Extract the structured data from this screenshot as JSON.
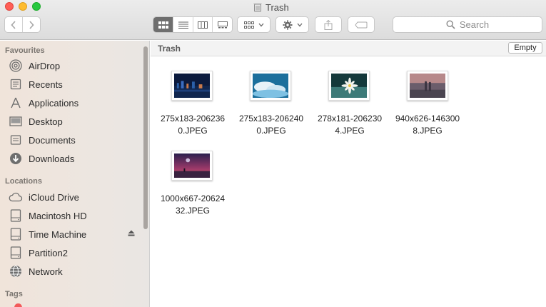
{
  "window": {
    "title": "Trash"
  },
  "toolbar": {
    "back_icon": "chevron-left-icon",
    "forward_icon": "chevron-right-icon",
    "view_modes": [
      "icon-view",
      "list-view",
      "column-view",
      "gallery-view"
    ],
    "active_view": "icon-view",
    "search_placeholder": "Search"
  },
  "sidebar": {
    "favourites_title": "Favourites",
    "favourites": [
      {
        "label": "AirDrop",
        "icon": "airdrop-icon"
      },
      {
        "label": "Recents",
        "icon": "recents-icon"
      },
      {
        "label": "Applications",
        "icon": "applications-icon"
      },
      {
        "label": "Desktop",
        "icon": "desktop-icon"
      },
      {
        "label": "Documents",
        "icon": "documents-icon"
      },
      {
        "label": "Downloads",
        "icon": "downloads-icon"
      }
    ],
    "locations_title": "Locations",
    "locations": [
      {
        "label": "iCloud Drive",
        "icon": "icloud-icon"
      },
      {
        "label": "Macintosh HD",
        "icon": "hard-drive-icon"
      },
      {
        "label": "Time Machine",
        "icon": "time-machine-icon"
      },
      {
        "label": "Partition2",
        "icon": "hard-drive-icon"
      },
      {
        "label": "Network",
        "icon": "network-icon"
      }
    ],
    "tags_title": "Tags"
  },
  "main": {
    "path_label": "Trash",
    "empty_button": "Empty",
    "files": [
      {
        "line1": "275x183-206236",
        "line2": "0.JPEG",
        "colors": [
          "#0b1a3d",
          "#2a5fa8",
          "#c97a4a"
        ]
      },
      {
        "line1": "275x183-206240",
        "line2": "0.JPEG",
        "colors": [
          "#1c6f9c",
          "#7ec1e3",
          "#e8f2f8"
        ]
      },
      {
        "line1": "278x181-206230",
        "line2": "4.JPEG",
        "colors": [
          "#14383a",
          "#3d7a78",
          "#f4f4ee"
        ]
      },
      {
        "line1": "940x626-146300",
        "line2": "8.JPEG",
        "colors": [
          "#6b5d6b",
          "#b7898a",
          "#3a3340"
        ]
      },
      {
        "line1": "1000x667-20624",
        "line2": "32.JPEG",
        "colors": [
          "#2a1f4d",
          "#a03a6a",
          "#e26a5a"
        ]
      }
    ]
  }
}
